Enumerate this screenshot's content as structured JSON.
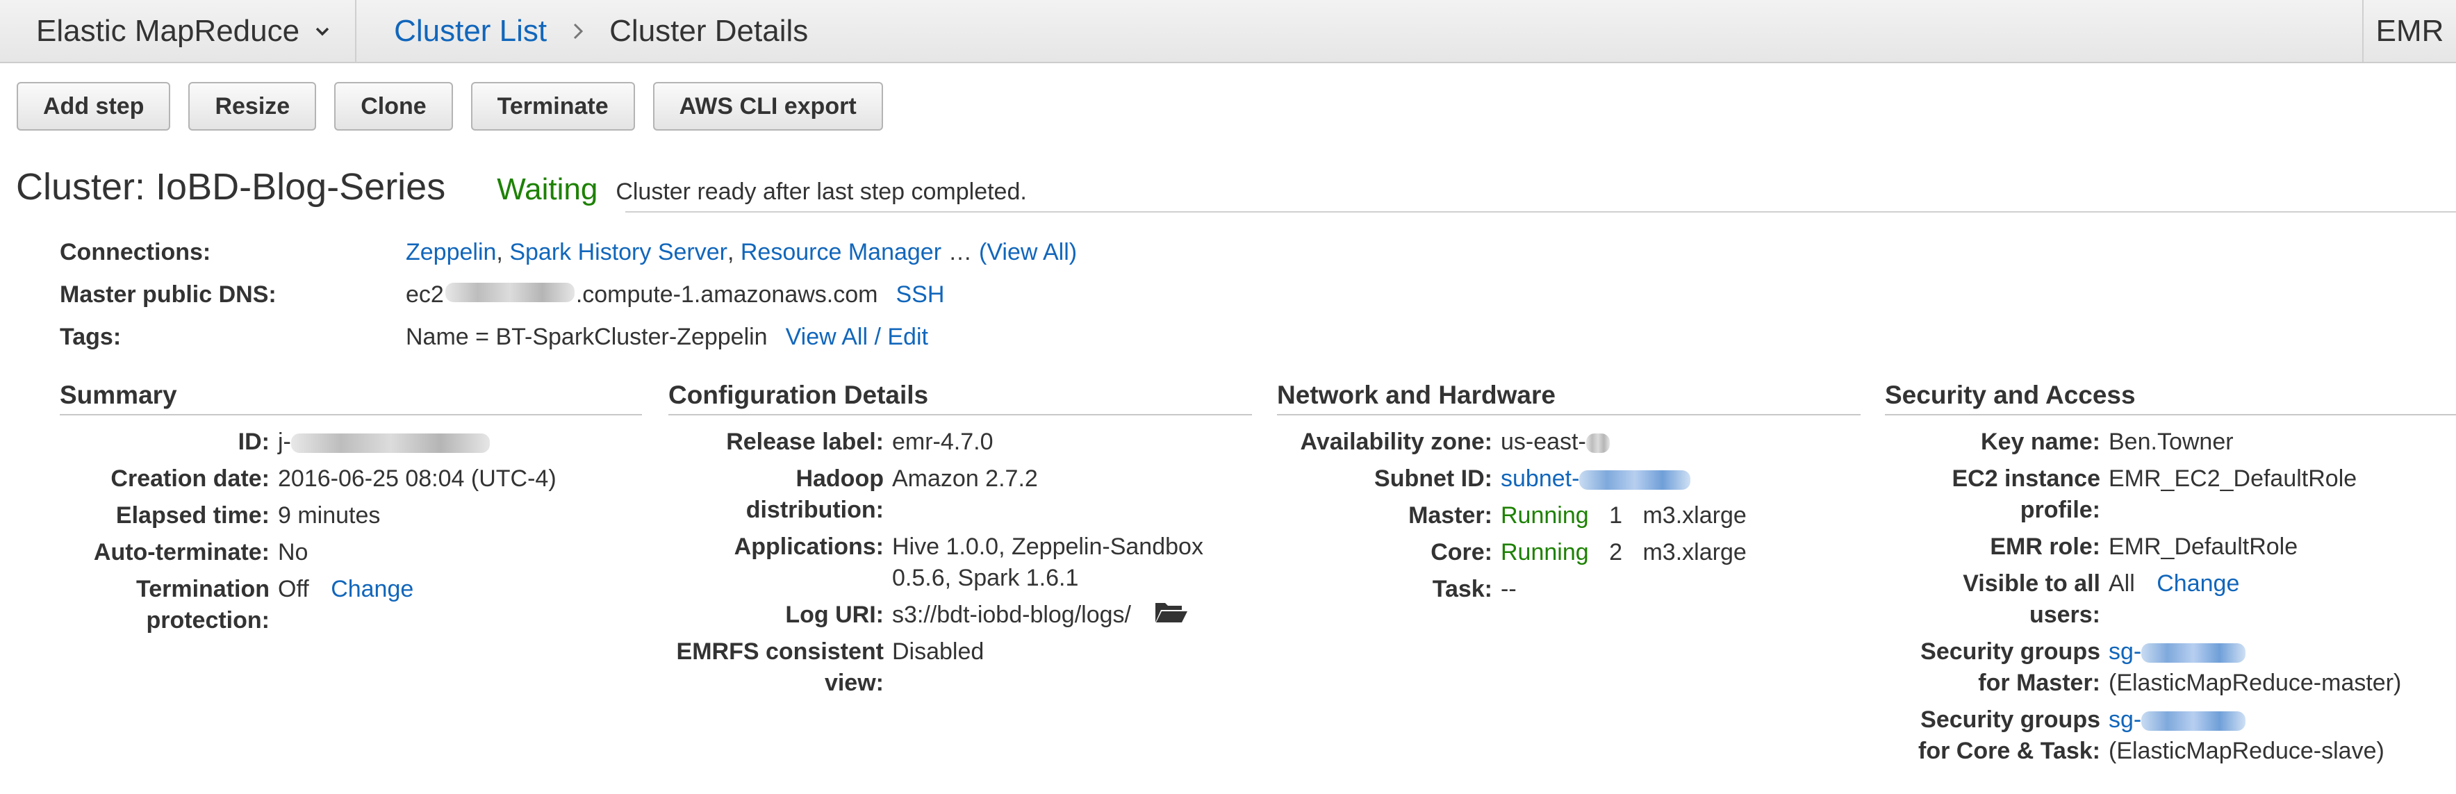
{
  "nav": {
    "service": "Elastic MapReduce",
    "breadcrumb_link": "Cluster List",
    "breadcrumb_current": "Cluster Details",
    "region": "EMR"
  },
  "buttons": [
    "Add step",
    "Resize",
    "Clone",
    "Terminate",
    "AWS CLI export"
  ],
  "cluster": {
    "title": "Cluster: IoBD-Blog-Series",
    "status": "Waiting",
    "status_message": "Cluster ready after last step completed."
  },
  "overview": {
    "connections_label": "Connections:",
    "connections": [
      "Zeppelin",
      "Spark History Server",
      "Resource Manager"
    ],
    "connections_more": "…",
    "connections_view_all": "(View All)",
    "dns_label": "Master public DNS:",
    "dns_prefix": "ec2",
    "dns_suffix": ".compute-1.amazonaws.com",
    "ssh": "SSH",
    "tags_label": "Tags:",
    "tags_value": "Name = BT-SparkCluster-Zeppelin",
    "tags_edit": "View All / Edit"
  },
  "summary": {
    "title": "Summary",
    "id_label": "ID:",
    "id_value": "j-",
    "creation_label": "Creation date:",
    "creation_value": "2016-06-25 08:04 (UTC-4)",
    "elapsed_label": "Elapsed time:",
    "elapsed_value": "9 minutes",
    "auto_label": "Auto-terminate:",
    "auto_value": "No",
    "term_label_1": "Termination",
    "term_label_2": "protection:",
    "term_value": "Off",
    "term_change": "Change"
  },
  "config": {
    "title": "Configuration Details",
    "release_label": "Release label:",
    "release_value": "emr-4.7.0",
    "hadoop_label_1": "Hadoop",
    "hadoop_label_2": "distribution:",
    "hadoop_value": "Amazon 2.7.2",
    "apps_label": "Applications:",
    "apps_value_1": "Hive 1.0.0, Zeppelin-Sandbox",
    "apps_value_2": "0.5.6, Spark 1.6.1",
    "log_label": "Log URI:",
    "log_value": "s3://bdt-iobd-blog/logs/",
    "emrfs_label_1": "EMRFS consistent",
    "emrfs_label_2": "view:",
    "emrfs_value": "Disabled"
  },
  "network": {
    "title": "Network and Hardware",
    "az_label": "Availability zone:",
    "az_value": "us-east-",
    "subnet_label": "Subnet ID:",
    "subnet_value": "subnet-",
    "master_label": "Master:",
    "master_status": "Running",
    "master_count": "1",
    "master_type": "m3.xlarge",
    "core_label": "Core:",
    "core_status": "Running",
    "core_count": "2",
    "core_type": "m3.xlarge",
    "task_label": "Task:",
    "task_value": "--"
  },
  "security": {
    "title": "Security and Access",
    "key_label": "Key name:",
    "key_value": "Ben.Towner",
    "ec2_label_1": "EC2 instance",
    "ec2_label_2": "profile:",
    "ec2_value": "EMR_EC2_DefaultRole",
    "emr_role_label": "EMR role:",
    "emr_role_value": "EMR_DefaultRole",
    "visible_label_1": "Visible to all",
    "visible_label_2": "users:",
    "visible_value": "All",
    "visible_change": "Change",
    "sg_master_label_1": "Security groups",
    "sg_master_label_2": "for Master:",
    "sg_master_value": "sg-",
    "sg_master_name": "(ElasticMapReduce-master)",
    "sg_core_label_1": "Security groups",
    "sg_core_label_2": "for Core & Task:",
    "sg_core_value": "sg-",
    "sg_core_name": "(ElasticMapReduce-slave)"
  },
  "icons": {
    "service_caret": "chevron-down-icon",
    "breadcrumb_separator": "chevron-right-icon",
    "log_folder": "folder-open-icon"
  },
  "colors": {
    "link": "#1166bb",
    "status_green": "#1d8102",
    "topbar": "#ebebeb"
  }
}
